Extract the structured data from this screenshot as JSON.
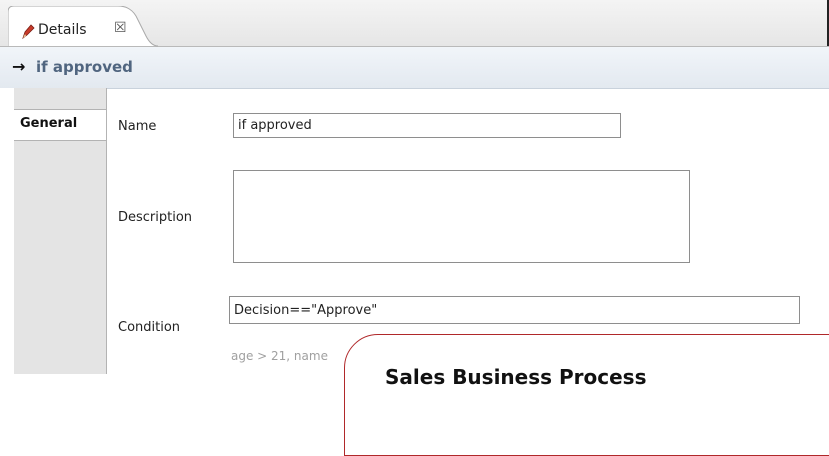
{
  "tab": {
    "label": "Details",
    "close_glyph": "☒",
    "icon": "pencil-icon"
  },
  "header": {
    "arrow": "→",
    "title": "if approved"
  },
  "sidetabs": [
    {
      "label": "General",
      "selected": true
    }
  ],
  "form": {
    "name_label": "Name",
    "name_value": "if approved",
    "description_label": "Description",
    "description_value": "",
    "condition_label": "Condition",
    "condition_value": "Decision==\"Approve\"",
    "condition_hint": "age > 21, name"
  },
  "overlay": {
    "title": "Sales Business Process"
  },
  "colors": {
    "title_text": "#50657f",
    "overlay_border": "#b0282a"
  }
}
